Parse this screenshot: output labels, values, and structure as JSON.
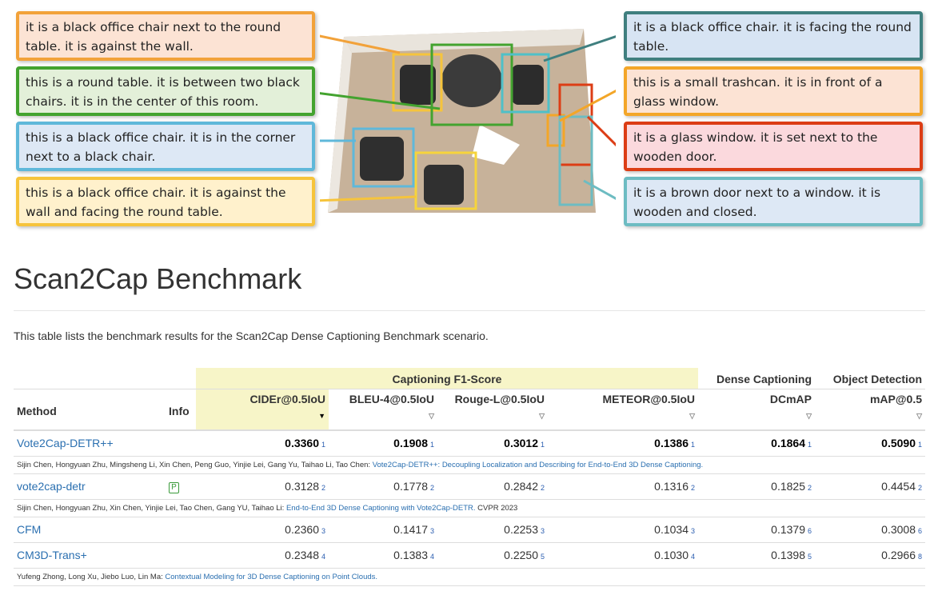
{
  "figure": {
    "captions": [
      {
        "text": "it is a black office chair next to the round table. it is against the wall.",
        "color": "#f2a23a",
        "bg": "#fce3d4"
      },
      {
        "text": "this is a round table. it is between two black chairs. it is in the center of this room.",
        "color": "#43a32f",
        "bg": "#e3f0d9"
      },
      {
        "text": "this is a black office chair. it is in the corner next to a black chair.",
        "color": "#5fb8da",
        "bg": "#dde8f5"
      },
      {
        "text": "this is a black office chair. it is against the wall and facing the round table.",
        "color": "#f6c43c",
        "bg": "#fff1cc"
      },
      {
        "text": "it is a black office chair. it is facing the round table.",
        "color": "#3f7f7f",
        "bg": "#d7e4f3"
      },
      {
        "text": "this is a small trashcan. it is in front of a glass window.",
        "color": "#f3a628",
        "bg": "#fce3d4"
      },
      {
        "text": "it is a glass window. it is set next to the wooden door.",
        "color": "#dc3d15",
        "bg": "#fbd9dd"
      },
      {
        "text": "it is a brown door next to a window. it is wooden and closed.",
        "color": "#6dbcc2",
        "bg": "#dde8f5"
      }
    ]
  },
  "page": {
    "title": "Scan2Cap Benchmark",
    "intro": "This table lists the benchmark results for the Scan2Cap Dense Captioning Benchmark scenario."
  },
  "table": {
    "groups": {
      "f1": "Captioning F1-Score",
      "dc": "Dense Captioning",
      "od": "Object Detection"
    },
    "headers": {
      "method": "Method",
      "info": "Info",
      "cider": "CIDEr@0.5IoU",
      "bleu": "BLEU-4@0.5IoU",
      "rouge": "Rouge-L@0.5IoU",
      "meteor": "METEOR@0.5IoU",
      "dcmap": "DCmAP",
      "map": "mAP@0.5"
    },
    "sort_icons": {
      "active": "▼",
      "inactive": "▽"
    },
    "rows": [
      {
        "method": "Vote2Cap-DETR++",
        "info": "",
        "cider": "0.3360",
        "cider_r": "1",
        "bleu": "0.1908",
        "bleu_r": "1",
        "rouge": "0.3012",
        "rouge_r": "1",
        "meteor": "0.1386",
        "meteor_r": "1",
        "dcmap": "0.1864",
        "dcmap_r": "1",
        "map": "0.5090",
        "map_r": "1",
        "authors": "Sijin Chen, Hongyuan Zhu, Mingsheng Li, Xin Chen, Peng Guo, Yinjie Lei, Gang Yu, Taihao Li, Tao Chen: ",
        "paper": "Vote2Cap-DETR++: Decoupling Localization and Describing for End-to-End 3D Dense Captioning.",
        "venue": ""
      },
      {
        "method": "vote2cap-detr",
        "info": "P",
        "cider": "0.3128",
        "cider_r": "2",
        "bleu": "0.1778",
        "bleu_r": "2",
        "rouge": "0.2842",
        "rouge_r": "2",
        "meteor": "0.1316",
        "meteor_r": "2",
        "dcmap": "0.1825",
        "dcmap_r": "2",
        "map": "0.4454",
        "map_r": "2",
        "authors": "Sijin Chen, Hongyuan Zhu, Xin Chen, Yinjie Lei, Tao Chen, Gang YU, Taihao Li: ",
        "paper": "End-to-End 3D Dense Captioning with Vote2Cap-DETR.",
        "venue": " CVPR 2023"
      },
      {
        "method": "CFM",
        "info": "",
        "cider": "0.2360",
        "cider_r": "3",
        "bleu": "0.1417",
        "bleu_r": "3",
        "rouge": "0.2253",
        "rouge_r": "3",
        "meteor": "0.1034",
        "meteor_r": "3",
        "dcmap": "0.1379",
        "dcmap_r": "6",
        "map": "0.3008",
        "map_r": "6",
        "authors": "",
        "paper": "",
        "venue": ""
      },
      {
        "method": "CM3D-Trans+",
        "info": "",
        "cider": "0.2348",
        "cider_r": "4",
        "bleu": "0.1383",
        "bleu_r": "4",
        "rouge": "0.2250",
        "rouge_r": "5",
        "meteor": "0.1030",
        "meteor_r": "4",
        "dcmap": "0.1398",
        "dcmap_r": "5",
        "map": "0.2966",
        "map_r": "8",
        "authors": "Yufeng Zhong, Long Xu, Jiebo Luo, Lin Ma: ",
        "paper": "Contextual Modeling for 3D Dense Captioning on Point Clouds.",
        "venue": ""
      }
    ]
  }
}
